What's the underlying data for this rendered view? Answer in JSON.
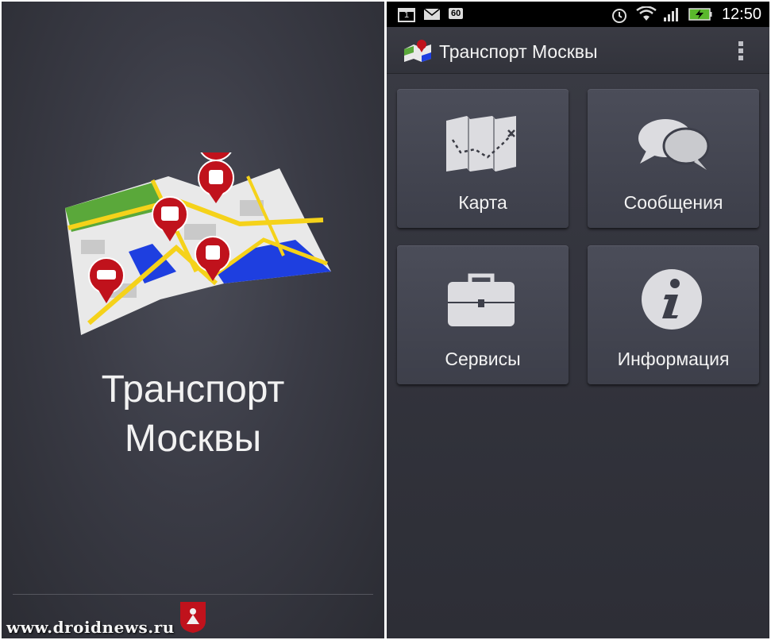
{
  "splash": {
    "title_line1": "Транспорт",
    "title_line2": "Москвы",
    "watermark": "www.droidnews.ru"
  },
  "status_bar": {
    "calendar_day": "1",
    "badge": "60",
    "time": "12:50"
  },
  "action_bar": {
    "title": "Транспорт Москвы"
  },
  "tiles": [
    {
      "label": "Карта",
      "icon": "folded-map-icon"
    },
    {
      "label": "Сообщения",
      "icon": "speech-bubbles-icon"
    },
    {
      "label": "Сервисы",
      "icon": "briefcase-icon"
    },
    {
      "label": "Информация",
      "icon": "info-icon"
    }
  ],
  "colors": {
    "accent_red": "#c0121c",
    "park_green": "#5aa83a",
    "water_blue": "#1e3fe0",
    "road_yellow": "#f5d21a"
  }
}
